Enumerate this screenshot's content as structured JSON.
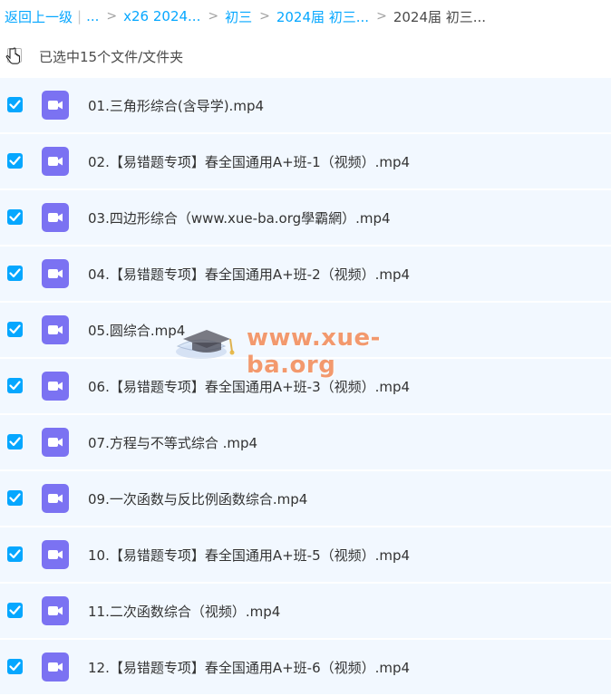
{
  "breadcrumb": {
    "back": "返回上一级",
    "pipe": "|",
    "ellipsis": "...",
    "items": [
      "x26 2024...",
      "初三",
      "2024届 初三...",
      "2024届 初三..."
    ],
    "separator": ">"
  },
  "selection": {
    "label": "已选中15个文件/文件夹"
  },
  "files": [
    {
      "name": "01.三角形综合(含导学).mp4",
      "checked": true
    },
    {
      "name": "02.【易错题专项】春全国通用A+班-1（视频）.mp4",
      "checked": true
    },
    {
      "name": "03.四边形综合（www.xue-ba.org學霸網）.mp4",
      "checked": true
    },
    {
      "name": "04.【易错题专项】春全国通用A+班-2（视频）.mp4",
      "checked": true
    },
    {
      "name": "05.圆综合.mp4",
      "checked": true
    },
    {
      "name": "06.【易错题专项】春全国通用A+班-3（视频）.mp4",
      "checked": true
    },
    {
      "name": "07.方程与不等式综合 .mp4",
      "checked": true
    },
    {
      "name": "09.一次函数与反比例函数综合.mp4",
      "checked": true
    },
    {
      "name": "10.【易错题专项】春全国通用A+班-5（视频）.mp4",
      "checked": true
    },
    {
      "name": "11.二次函数综合（视频）.mp4",
      "checked": true
    },
    {
      "name": "12.【易错题专项】春全国通用A+班-6（视频）.mp4",
      "checked": true
    }
  ],
  "watermark": {
    "text": "www.xue-ba.org"
  },
  "colors": {
    "accent": "#06a7ff",
    "row_bg": "#f2f8ff",
    "video_icon": "#7b72f2"
  },
  "icons": {
    "file_type": "video-file-icon",
    "cursor": "hand-cursor-icon"
  }
}
